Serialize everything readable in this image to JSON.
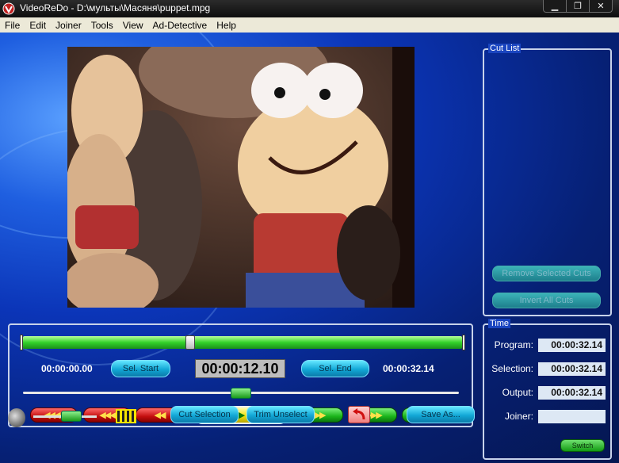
{
  "window": {
    "title": "VideoReDo - D:\\мульты\\Масяня\\puppet.mpg",
    "min_label": "▁",
    "max_label": "❐",
    "close_label": "✕"
  },
  "menu": [
    "File",
    "Edit",
    "Joiner",
    "Tools",
    "View",
    "Ad-Detective",
    "Help"
  ],
  "cut_list": {
    "label": "Cut List",
    "remove_label": "Remove Selected Cuts",
    "invert_label": "Invert All Cuts"
  },
  "time_panel": {
    "label": "Time",
    "rows": [
      {
        "label": "Program:",
        "value": "00:00:32.14"
      },
      {
        "label": "Selection:",
        "value": "00:00:32.14"
      },
      {
        "label": "Output:",
        "value": "00:00:32.14"
      },
      {
        "label": "Joiner:",
        "value": ""
      }
    ],
    "switch_label": "Switch"
  },
  "controls": {
    "start_time": "00:00:00.00",
    "sel_start_label": "Sel. Start",
    "current_time": "00:00:12.10",
    "sel_end_label": "Sel. End",
    "end_time": "00:00:32.14",
    "position_fraction": 0.38,
    "jog_fraction": 0.5,
    "transport": {
      "rew4": "◀◀◀◀",
      "rew3": "◀◀◀",
      "rew2": "◀◀",
      "play": "▶",
      "fwd2": "▶▶",
      "fwd3": "▶▶▶",
      "fwd4": "▶▶▶▶"
    }
  },
  "bottom_bar": {
    "volume_fraction": 0.6,
    "cut_selection_label": "Cut Selection",
    "trim_unselect_label": "Trim Unselect",
    "save_as_label": "Save As..."
  }
}
